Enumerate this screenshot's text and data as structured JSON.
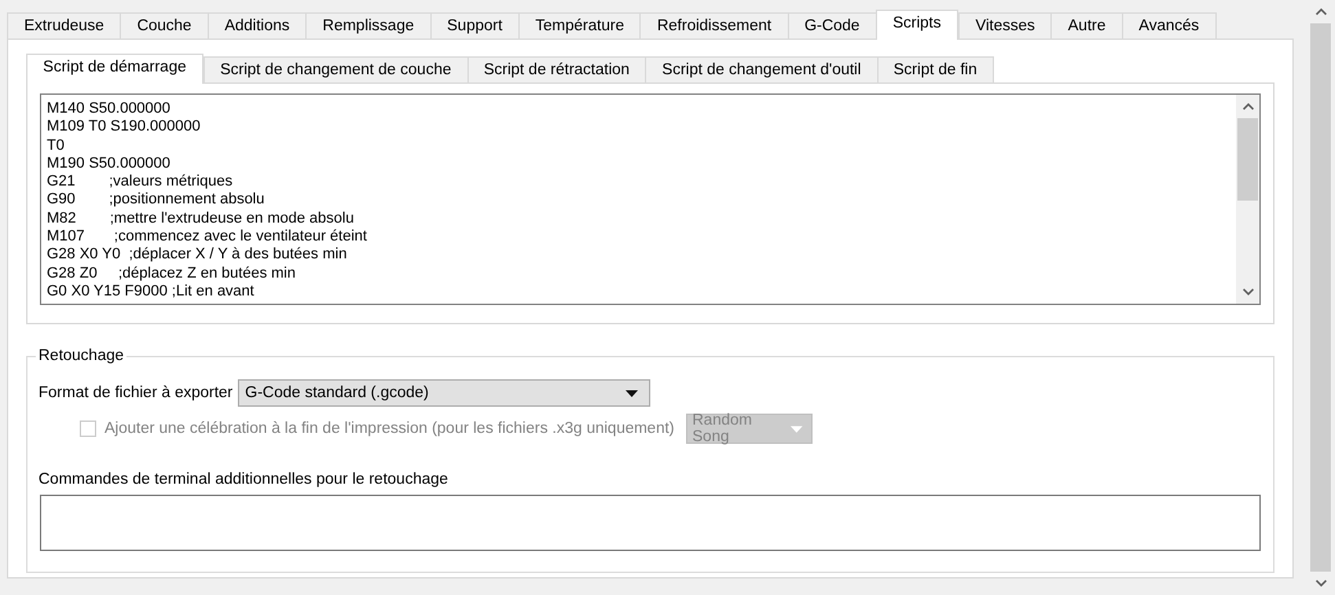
{
  "tabs": [
    {
      "label": "Extrudeuse",
      "selected": false
    },
    {
      "label": "Couche",
      "selected": false
    },
    {
      "label": "Additions",
      "selected": false
    },
    {
      "label": "Remplissage",
      "selected": false
    },
    {
      "label": "Support",
      "selected": false
    },
    {
      "label": "Température",
      "selected": false
    },
    {
      "label": "Refroidissement",
      "selected": false
    },
    {
      "label": "G-Code",
      "selected": false
    },
    {
      "label": "Scripts",
      "selected": true
    },
    {
      "label": "Vitesses",
      "selected": false
    },
    {
      "label": "Autre",
      "selected": false
    },
    {
      "label": "Avancés",
      "selected": false
    }
  ],
  "script_tabs": [
    {
      "label": "Script de démarrage",
      "selected": true
    },
    {
      "label": "Script de changement de couche",
      "selected": false
    },
    {
      "label": "Script de rétractation",
      "selected": false
    },
    {
      "label": "Script de changement d'outil",
      "selected": false
    },
    {
      "label": "Script de fin",
      "selected": false
    }
  ],
  "script_lines": [
    "M140 S50.000000",
    "M109 T0 S190.000000",
    "T0",
    "M190 S50.000000",
    "G21        ;valeurs métriques",
    "G90        ;positionnement absolu",
    "M82        ;mettre l'extrudeuse en mode absolu",
    "M107       ;commencez avec le ventilateur éteint",
    "G28 X0 Y0  ;déplacer X / Y à des butées min",
    "G28 Z0     ;déplacez Z en butées min",
    "G0 X0 Y15 F9000 ;Lit en avant"
  ],
  "retouchage": {
    "title": "Retouchage",
    "format_label": "Format de fichier à exporter",
    "format_value": "G-Code standard (.gcode)",
    "celebration": {
      "label": "Ajouter une célébration à la fin de l'impression (pour les fichiers .x3g uniquement)",
      "checked": false,
      "disabled": true
    },
    "song": {
      "value": "Random Song",
      "disabled": true
    },
    "commands_label": "Commandes de terminal additionnelles pour le retouchage"
  }
}
